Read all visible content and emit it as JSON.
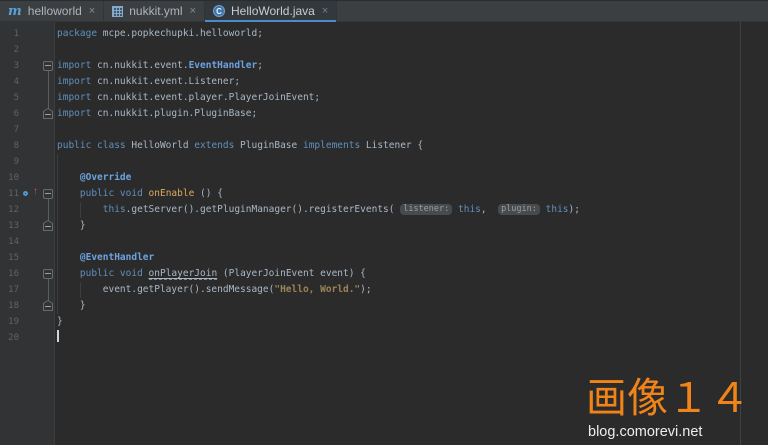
{
  "tab_bar": {
    "tabs": [
      {
        "label": "helloworld",
        "icon": "maven-module-icon",
        "icon_glyph": "m",
        "close": "×",
        "active": false
      },
      {
        "label": "nukkit.yml",
        "icon": "yaml-table-icon",
        "close": "×",
        "active": false
      },
      {
        "label": "HelloWorld.java",
        "icon": "java-class-icon",
        "icon_glyph": "C",
        "close": "×",
        "active": true
      }
    ]
  },
  "editor": {
    "caret_line": 20,
    "colors": {
      "background": "#2B2B2B",
      "gutter": "#313335",
      "line_number": "#606366",
      "text": "#A9B7C6",
      "keyword": "#6090BD",
      "annotation": "#6DA2E0",
      "method_declaration": "#DCA95C",
      "string": "#9C8455",
      "tab_underline": "#4A8CC9"
    },
    "lines": [
      {
        "n": 1,
        "t": [
          [
            "kw",
            "package"
          ],
          [
            "tx",
            " mcpe.popkechupki.helloworld;"
          ]
        ]
      },
      {
        "n": 2,
        "t": []
      },
      {
        "n": 3,
        "fold": "start",
        "t": [
          [
            "kw",
            "import"
          ],
          [
            "tx",
            " cn.nukkit.event."
          ],
          [
            "an",
            "EventHandler"
          ],
          [
            "tx",
            ";"
          ]
        ]
      },
      {
        "n": 4,
        "t": [
          [
            "kw",
            "import"
          ],
          [
            "tx",
            " cn.nukkit.event.Listener;"
          ]
        ]
      },
      {
        "n": 5,
        "t": [
          [
            "kw",
            "import"
          ],
          [
            "tx",
            " cn.nukkit.event.player.PlayerJoinEvent;"
          ]
        ]
      },
      {
        "n": 6,
        "fold": "end",
        "t": [
          [
            "kw",
            "import"
          ],
          [
            "tx",
            " cn.nukkit.plugin.PluginBase;"
          ]
        ]
      },
      {
        "n": 7,
        "t": []
      },
      {
        "n": 8,
        "t": [
          [
            "kw",
            "public class"
          ],
          [
            "tx",
            " HelloWorld "
          ],
          [
            "kw",
            "extends"
          ],
          [
            "tx",
            " PluginBase "
          ],
          [
            "kw",
            "implements"
          ],
          [
            "tx",
            " Listener {"
          ]
        ]
      },
      {
        "n": 9,
        "t": []
      },
      {
        "n": 10,
        "t": [
          [
            "tx",
            "    "
          ],
          [
            "an",
            "@Override"
          ]
        ]
      },
      {
        "n": 11,
        "fold": "start",
        "gutter": "override",
        "t": [
          [
            "tx",
            "    "
          ],
          [
            "kw",
            "public void"
          ],
          [
            "tx",
            " "
          ],
          [
            "mt",
            "onEnable"
          ],
          [
            "tx",
            " () {"
          ]
        ]
      },
      {
        "n": 12,
        "t": [
          [
            "tx",
            "        "
          ],
          [
            "kw",
            "this"
          ],
          [
            "tx",
            ".getServer().getPluginManager().registerEvents( "
          ],
          [
            "ph",
            "listener:"
          ],
          [
            "tx",
            " "
          ],
          [
            "kw",
            "this"
          ],
          [
            "tx",
            ",  "
          ],
          [
            "ph",
            "plugin:"
          ],
          [
            "tx",
            " "
          ],
          [
            "kw",
            "this"
          ],
          [
            "tx",
            ");"
          ]
        ]
      },
      {
        "n": 13,
        "fold": "end",
        "t": [
          [
            "tx",
            "    }"
          ]
        ]
      },
      {
        "n": 14,
        "t": []
      },
      {
        "n": 15,
        "t": [
          [
            "tx",
            "    "
          ],
          [
            "an",
            "@EventHandler"
          ]
        ]
      },
      {
        "n": 16,
        "fold": "start",
        "t": [
          [
            "tx",
            "    "
          ],
          [
            "kw",
            "public void"
          ],
          [
            "tx",
            " "
          ],
          [
            "wr",
            "onPlayerJoin"
          ],
          [
            "tx",
            " (PlayerJoinEvent event) {"
          ]
        ]
      },
      {
        "n": 17,
        "t": [
          [
            "tx",
            "        event.getPlayer().sendMessage("
          ],
          [
            "st",
            "\"Hello, World.\""
          ],
          [
            "tx",
            ");"
          ]
        ]
      },
      {
        "n": 18,
        "fold": "end",
        "t": [
          [
            "tx",
            "    }"
          ]
        ]
      },
      {
        "n": 19,
        "t": [
          [
            "tx",
            "}"
          ]
        ]
      },
      {
        "n": 20,
        "caret": true,
        "t": []
      }
    ]
  },
  "watermark": {
    "title": "画像１４",
    "url": "blog.comorevi.net",
    "color": "#F08418"
  }
}
